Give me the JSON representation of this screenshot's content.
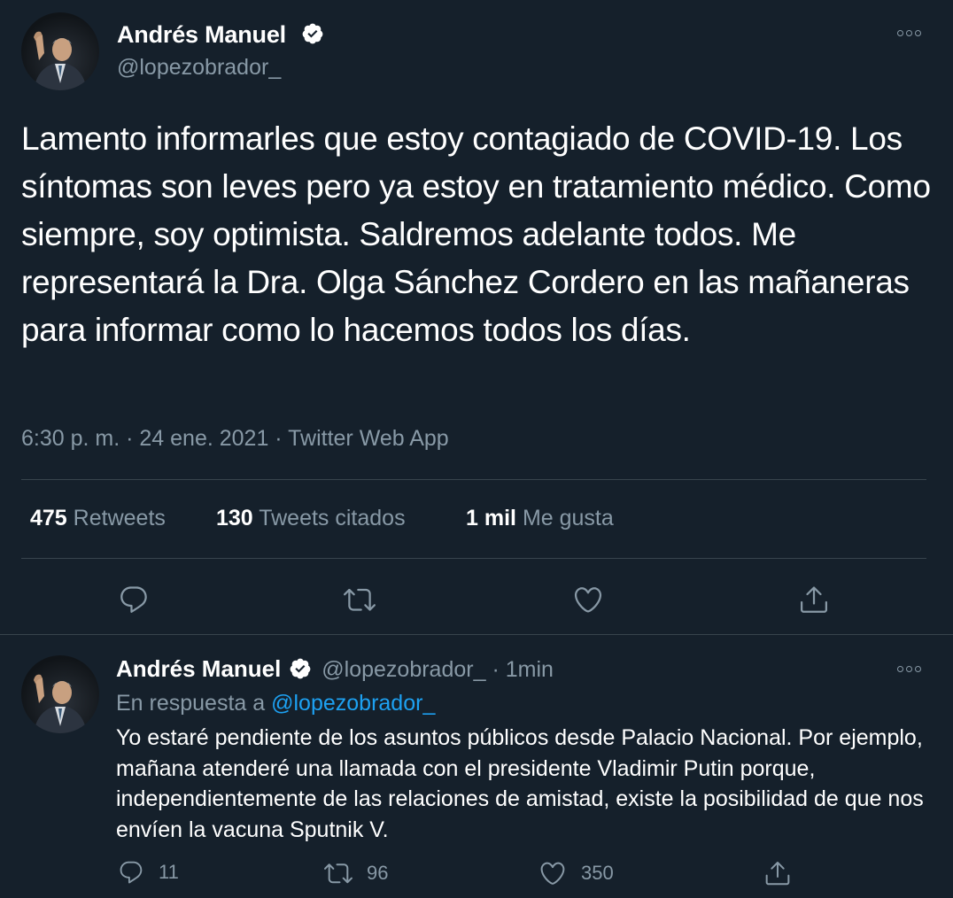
{
  "main_tweet": {
    "display_name": "Andrés Manuel",
    "handle": "@lopezobrador_",
    "text": "Lamento informarles que estoy contagiado de COVID-19. Los síntomas son leves pero ya estoy en tratamiento médico. Como siempre, soy optimista. Saldremos adelante todos. Me representará la Dra. Olga Sánchez Cordero en las mañaneras para informar como lo hacemos todos los días.",
    "meta": "6:30 p. m. · 24 ene. 2021 · Twitter Web App",
    "stats": {
      "retweets_count": "475",
      "retweets_label": "Retweets",
      "quotes_count": "130",
      "quotes_label": "Tweets citados",
      "likes_count": "1 mil",
      "likes_label": "Me gusta"
    },
    "icons": [
      "reply-icon",
      "retweet-icon",
      "like-icon",
      "share-icon"
    ]
  },
  "reply_tweet": {
    "display_name": "Andrés Manuel",
    "handle": "@lopezobrador_",
    "dot": "·",
    "time": "1min",
    "in_reply_prefix": "En respuesta a",
    "in_reply_handle": "@lopezobrador_",
    "text": "Yo estaré pendiente de los asuntos públicos desde Palacio Nacional. Por ejemplo, mañana atenderé una llamada con el presidente Vladimir Putin porque, independientemente de las relaciones de amistad, existe la posibilidad de que nos envíen la vacuna Sputnik V.",
    "reply_count": "11",
    "retweet_count": "96",
    "like_count": "350"
  },
  "colors": {
    "background": "#15202b",
    "text_primary": "#ffffff",
    "text_secondary": "#8899a6",
    "link": "#1da1f2",
    "divider": "#38444d"
  }
}
